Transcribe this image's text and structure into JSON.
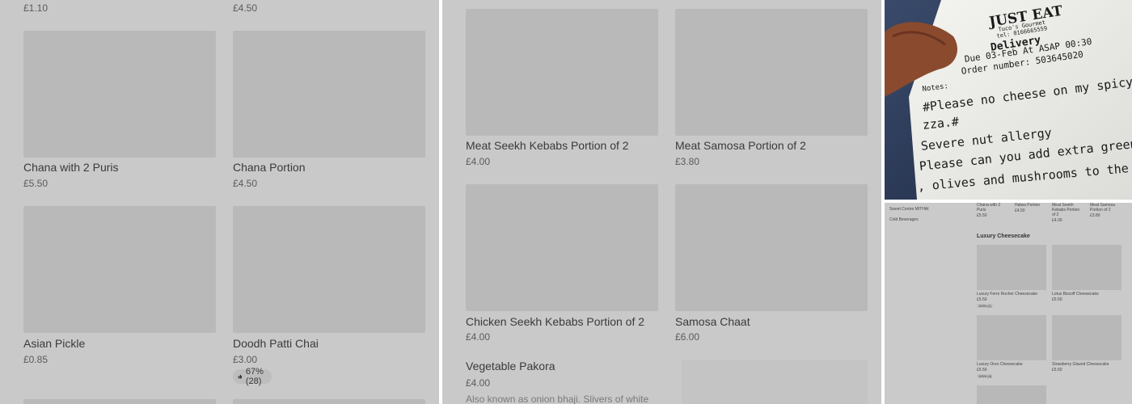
{
  "panel_left": {
    "top_prices": [
      "£1.10",
      "£4.50"
    ],
    "items": [
      {
        "name": "Chana with 2 Puris",
        "price": "£5.50"
      },
      {
        "name": "Chana Portion",
        "price": "£4.50"
      },
      {
        "name": "Asian Pickle",
        "price": "£0.85"
      },
      {
        "name": "Doodh Patti Chai",
        "price": "£3.00",
        "rating": "67% (28)"
      }
    ]
  },
  "panel_middle": {
    "items": [
      {
        "name": "Meat Seekh Kebabs Portion of 2",
        "price": "£4.00"
      },
      {
        "name": "Meat Samosa Portion of 2",
        "price": "£3.80"
      },
      {
        "name": "Chicken Seekh Kebabs Portion of 2",
        "price": "£4.00"
      },
      {
        "name": "Samosa Chaat",
        "price": "£6.00"
      }
    ],
    "featured": {
      "name": "Vegetable Pakora",
      "price": "£4.00",
      "description": "Also known as onion bhaji. Slivers of white"
    }
  },
  "receipt": {
    "brand": "JUST EAT",
    "restaurant": "Tuco's Gourmet",
    "tel": "tel: 0166665559",
    "type": "Delivery",
    "due": "Due 03-Feb At ASAP 00:30",
    "order": "Order number:  503645020",
    "notes_label": "Notes:",
    "lines": [
      "#Please no cheese on my spicy pollo pi",
      "zza.#",
      "Severe nut allergy",
      "Please can you add extra green peppers",
      ", olives and mushrooms to the pollo pi"
    ]
  },
  "mini_screen": {
    "sidebar": [
      "Sweet Centre MITHAI",
      "Cold Beverages"
    ],
    "top_items": [
      {
        "name": "Chana with 2\nPuris",
        "price": "£5.50"
      },
      {
        "name": "Halwa Portion",
        "price": "£4.50"
      },
      {
        "name": "Meat Seekh\nKebabs Portion\nof 2",
        "price": "£4.00"
      },
      {
        "name": "Meat Samosa\nPortion of 2",
        "price": "£3.80"
      }
    ],
    "section": "Luxury Cheesecake",
    "cheesecakes": [
      {
        "name": "Luxury Ferro Rocher Cheesecake",
        "price": "£5.50",
        "rating": "100% (1)"
      },
      {
        "name": "Lotus Biscoff Cheesecake",
        "price": "£5.50"
      },
      {
        "name": "Luxury Oreo Cheesecake",
        "price": "£5.50",
        "rating": "100% (4)"
      },
      {
        "name": "Strawberry Glazed Cheesecake",
        "price": "£5.50"
      }
    ]
  }
}
